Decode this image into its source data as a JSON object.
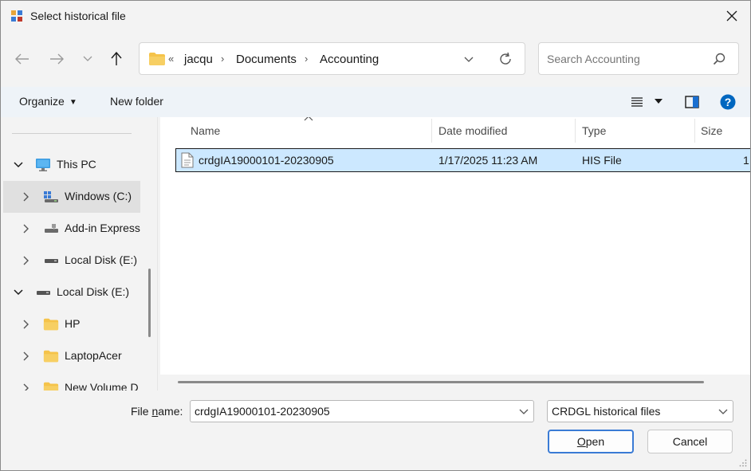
{
  "window": {
    "title": "Select historical file"
  },
  "address": {
    "overflow": "«",
    "segments": [
      "jacqu",
      "Documents",
      "Accounting"
    ],
    "separator": "›"
  },
  "search": {
    "placeholder": "Search Accounting"
  },
  "commands": {
    "organize": "Organize",
    "new_folder": "New folder"
  },
  "nav": {
    "items": [
      {
        "label": "This PC",
        "icon": "monitor-icon",
        "level": 0,
        "expanded": true
      },
      {
        "label": "Windows (C:)",
        "icon": "windows-drive-icon",
        "level": 1,
        "selected": true
      },
      {
        "label": "Add-in Express",
        "icon": "network-drive-icon",
        "level": 1
      },
      {
        "label": "Local Disk (E:)",
        "icon": "drive-icon",
        "level": 1
      },
      {
        "label": "Local Disk (E:)",
        "icon": "drive-icon",
        "level": 0,
        "expanded": true
      },
      {
        "label": "HP",
        "icon": "folder-icon",
        "level": 1
      },
      {
        "label": "LaptopAcer",
        "icon": "folder-icon",
        "level": 1
      },
      {
        "label": "New Volume D",
        "icon": "folder-icon",
        "level": 1
      }
    ]
  },
  "columns": [
    "Name",
    "Date modified",
    "Type",
    "Size"
  ],
  "files": [
    {
      "name": "crdgIA19000101-20230905",
      "date": "1/17/2025 11:23 AM",
      "type": "HIS File",
      "size": "1",
      "selected": true
    }
  ],
  "footer": {
    "filename_label_prefix": "File ",
    "filename_label_mnemonic": "n",
    "filename_label_suffix": "ame:",
    "filename_value": "crdgIA19000101-20230905",
    "filter_value": "CRDGL historical files",
    "open_mnemonic": "O",
    "open_rest": "pen",
    "cancel": "Cancel"
  },
  "colors": {
    "accent": "#0067c0",
    "selection": "#cce8ff",
    "folder": "#f5c34a"
  }
}
